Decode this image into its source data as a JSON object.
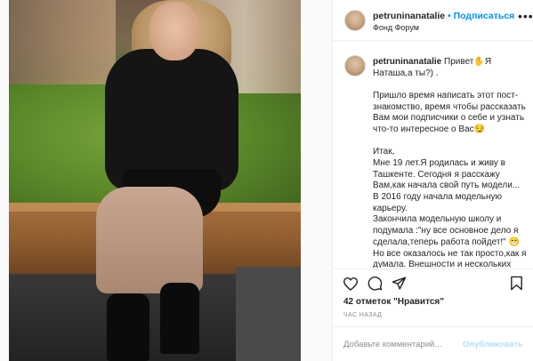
{
  "post": {
    "username": "petruninanatalie",
    "separator": "•",
    "follow_label": "Подписаться",
    "location": "Фонд Форум"
  },
  "caption": {
    "username": "petruninanatalie",
    "lines": [
      "Привет✋Я Наташа,а ты?) .",
      "Пришло время написать этот пост-знакомство, время чтобы рассказать Вам мои подписчики о себе и узнать что-то интересное о Вас😏",
      "Итак,",
      "Мне 19 лет.Я родилась и живу в Ташкенте. Сегодня я расскажу Вам,как начала свой путь модели... В 2016 году начала модельную карьеру.",
      "Закончила модельную школу и подумала :\"ну все основное дело я сделала,теперь работа пойдет!\" 😁 Но все оказалось не так просто,как я думала. Внешности и нескольких месяцев в модельной школе не"
    ]
  },
  "actions": {
    "like_icon": "heart-icon",
    "comment_icon": "comment-icon",
    "share_icon": "share-icon",
    "save_icon": "bookmark-icon",
    "likes_text": "42 отметок \"Нравится\"",
    "time_text": "ЧАС НАЗАД"
  },
  "composer": {
    "placeholder": "Добавьте комментарий...",
    "publish_label": "Опубликовать"
  },
  "colors": {
    "accent": "#0095f6",
    "publish_disabled": "#b2dffc",
    "muted": "#8e8e8e"
  }
}
